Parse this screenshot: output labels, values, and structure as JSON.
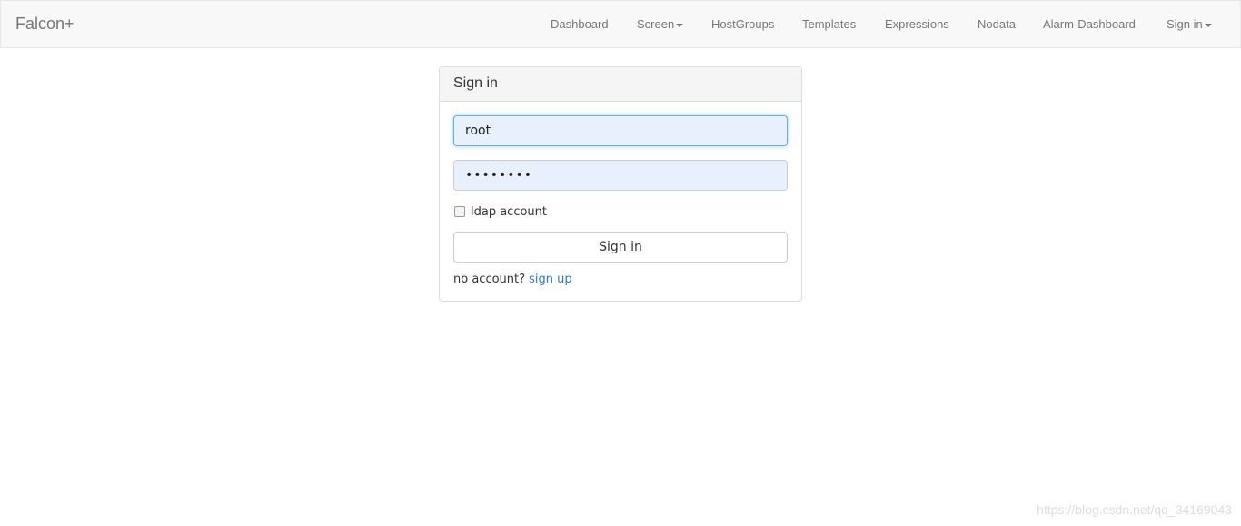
{
  "navbar": {
    "brand": "Falcon+",
    "items": [
      {
        "label": "Dashboard",
        "dropdown": false
      },
      {
        "label": "Screen",
        "dropdown": true
      },
      {
        "label": "HostGroups",
        "dropdown": false
      },
      {
        "label": "Templates",
        "dropdown": false
      },
      {
        "label": "Expressions",
        "dropdown": false
      },
      {
        "label": "Nodata",
        "dropdown": false
      },
      {
        "label": "Alarm-Dashboard",
        "dropdown": false
      },
      {
        "label": "Sign in",
        "dropdown": true
      }
    ]
  },
  "signin_panel": {
    "heading": "Sign in",
    "username_value": "root",
    "password_masked": "••••••••",
    "ldap_label": "ldap account",
    "ldap_checked": false,
    "submit_label": "Sign in",
    "no_account_text": "no account?",
    "signup_link": "sign up"
  },
  "watermark": "https://blog.csdn.net/qq_34169043",
  "colors": {
    "navbar_bg": "#f8f8f8",
    "input_autofill_bg": "#e8f0fe",
    "link": "#337ab7",
    "focus_border": "#66afe9"
  }
}
